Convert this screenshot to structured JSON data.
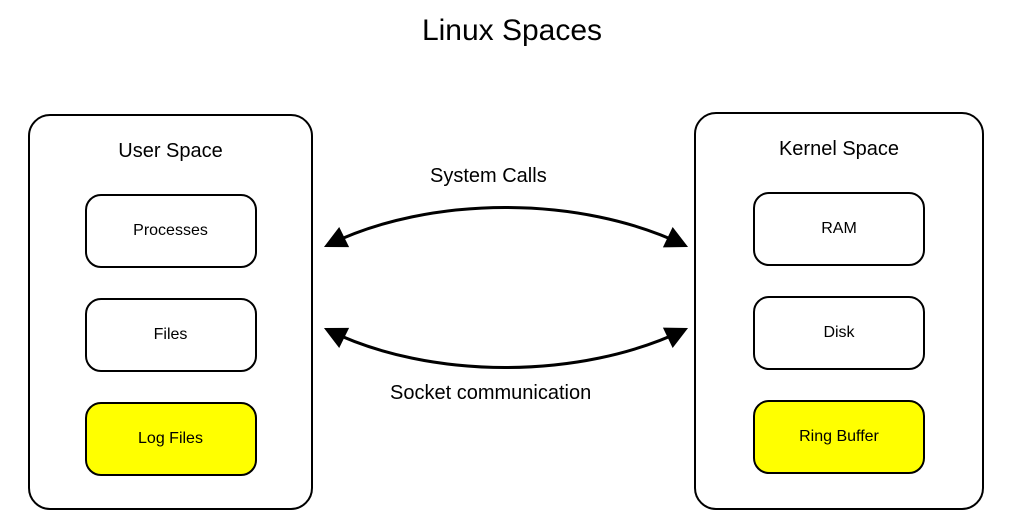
{
  "title": "Linux Spaces",
  "left_panel": {
    "title": "User Space",
    "items": [
      {
        "label": "Processes",
        "highlight": false
      },
      {
        "label": "Files",
        "highlight": false
      },
      {
        "label": "Log Files",
        "highlight": true
      }
    ]
  },
  "right_panel": {
    "title": "Kernel Space",
    "items": [
      {
        "label": "RAM",
        "highlight": false
      },
      {
        "label": "Disk",
        "highlight": false
      },
      {
        "label": "Ring Buffer",
        "highlight": true
      }
    ]
  },
  "connections": {
    "top_label": "System Calls",
    "bottom_label": "Socket communication"
  },
  "colors": {
    "highlight": "#ffff00",
    "stroke": "#000000"
  }
}
